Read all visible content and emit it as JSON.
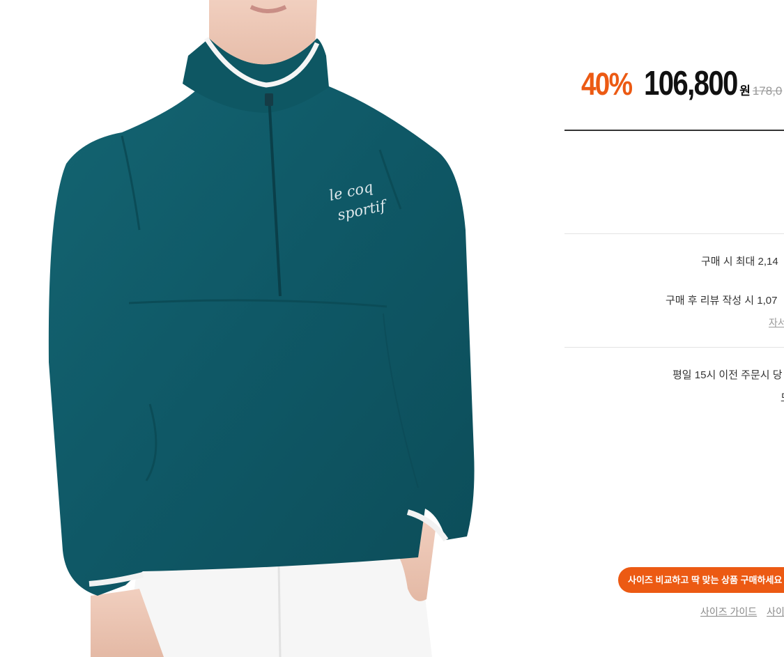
{
  "product": {
    "image_alt": "model wearing teal half-zip fleece pullover",
    "logo_text_1": "le coq",
    "logo_text_2": "sportif"
  },
  "price": {
    "discount_rate": "40%",
    "sale_price": "106,800",
    "currency": "원",
    "original_price": "178,0"
  },
  "benefits": {
    "max_points": "구매 시 최대 2,14",
    "review_points": "구매 후 리뷰 작성 시 1,07",
    "detail_link": "자서"
  },
  "delivery": {
    "line1": "평일 15시 이전 주문시 당",
    "line2": "도"
  },
  "size": {
    "banner_text": "사이즈 비교하고 딱 맞는 상품 구매하세요",
    "guide_link": "사이즈 가이드",
    "second_link": "사이"
  },
  "colors": {
    "accent": "#ec5a13",
    "garment_teal": "#0f5a66"
  }
}
